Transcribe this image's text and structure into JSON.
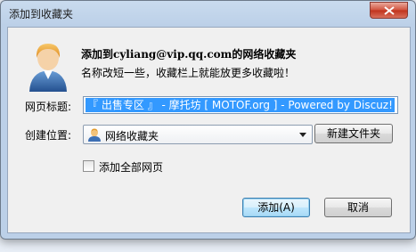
{
  "dialog": {
    "title": "添加到收藏夹"
  },
  "header": {
    "heading_prefix": "添加到",
    "heading_email": "cyliang@vip.qq.com",
    "heading_suffix": "的网络收藏夹",
    "subtext": "名称改短一些，收藏栏上就能放更多收藏啦！"
  },
  "form": {
    "title_label": "网页标题:",
    "title_value": "『 出售专区 』 - 摩托坊 [ MOTOF.org ] - Powered by Discuz!",
    "location_label": "创建位置:",
    "location_value": "网络收藏夹",
    "new_folder_label": "新建文件夹",
    "add_all_label": "添加全部网页",
    "add_all_checked": false
  },
  "buttons": {
    "add_label": "添加(A)",
    "cancel_label": "取消"
  }
}
